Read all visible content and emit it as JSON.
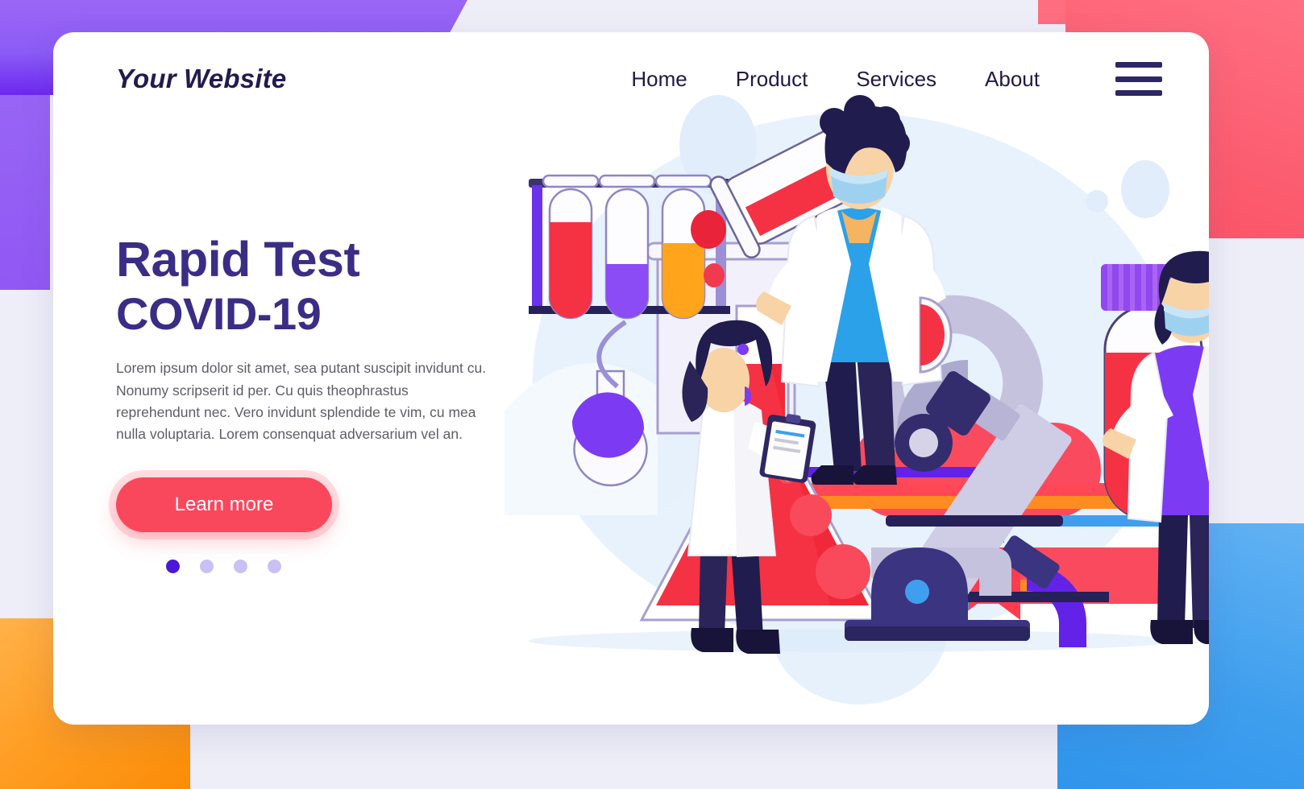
{
  "palette": {
    "purple_block": "#8B5CF6",
    "pink_block": "#FC5C6F",
    "orange_block": "#FF9E24",
    "blue_block": "#3F9FEE",
    "page_bg": "#EEEEF8",
    "heading": "#3A2D85",
    "logo": "#231B4E",
    "cta": "#F9485C",
    "nav": "#1F1A45",
    "body_text": "#5D5D66",
    "dot_active": "#4B18D6",
    "dot_inactive": "#C9C0F5"
  },
  "header": {
    "logo": "Your Website",
    "nav": [
      {
        "label": "Home"
      },
      {
        "label": "Product"
      },
      {
        "label": "Services"
      },
      {
        "label": "About"
      }
    ],
    "menu_icon": "hamburger-menu-icon"
  },
  "hero": {
    "title_line1": "Rapid Test",
    "title_line2": "COVID-19",
    "description": "Lorem ipsum dolor sit amet, sea putant suscipit invidunt cu. Nonumy scripserit id per. Cu quis theophrastus reprehendunt nec. Vero invidunt splendide te vim, cu mea nulla voluptaria. Lorem consenquat adversarium vel an.",
    "cta_label": "Learn more",
    "carousel": {
      "total": 4,
      "active_index": 0
    }
  },
  "illustration": {
    "name": "covid-19-laboratory-testing-illustration",
    "elements": [
      "scientist-pouring-test-tube",
      "scientist-with-clipboard",
      "scientist-holding-blood-sample",
      "large-beaker",
      "large-red-conical-flask",
      "round-bottom-flask-purple",
      "test-tube-rack",
      "microscope",
      "blood-sample-tube"
    ]
  }
}
